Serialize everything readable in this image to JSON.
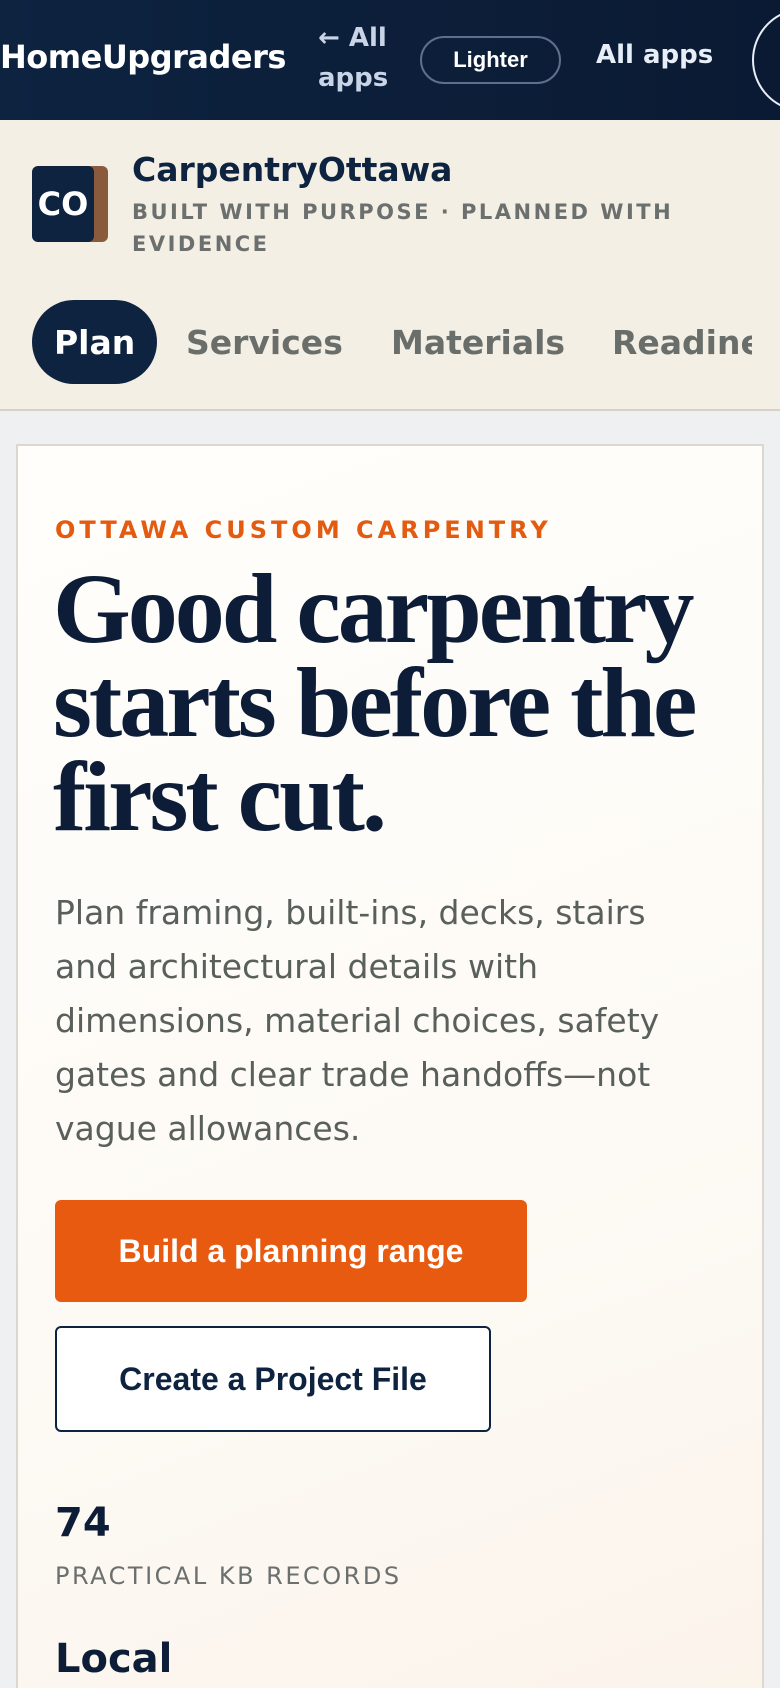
{
  "topnav": {
    "brand": "HomeUpgraders",
    "back_link": "← All apps",
    "theme_toggle": "Lighter",
    "all_apps": "All apps"
  },
  "site": {
    "logo_text": "CO",
    "name": "CarpentryOttawa",
    "tagline": "BUILT WITH PURPOSE · PLANNED WITH EVIDENCE",
    "tabs": [
      {
        "label": "Plan",
        "active": true
      },
      {
        "label": "Services",
        "active": false
      },
      {
        "label": "Materials",
        "active": false
      },
      {
        "label": "Readiness",
        "active": false
      }
    ]
  },
  "hero": {
    "eyebrow": "OTTAWA CUSTOM CARPENTRY",
    "headline": "Good carpentry starts before the first cut.",
    "lead": "Plan framing, built-ins, decks, stairs and architectural details with dimensions, material choices, safety gates and clear trade handoffs—not vague allowances.",
    "primary_cta": "Build a planning range",
    "secondary_cta": "Create a Project File",
    "stats": [
      {
        "value": "74",
        "label": "PRACTICAL KB RECORDS"
      },
      {
        "value": "Local",
        "label": ""
      }
    ]
  },
  "colors": {
    "navy": "#0d2340",
    "accent_orange": "#e75a10",
    "header_bg": "#f4efe4"
  }
}
